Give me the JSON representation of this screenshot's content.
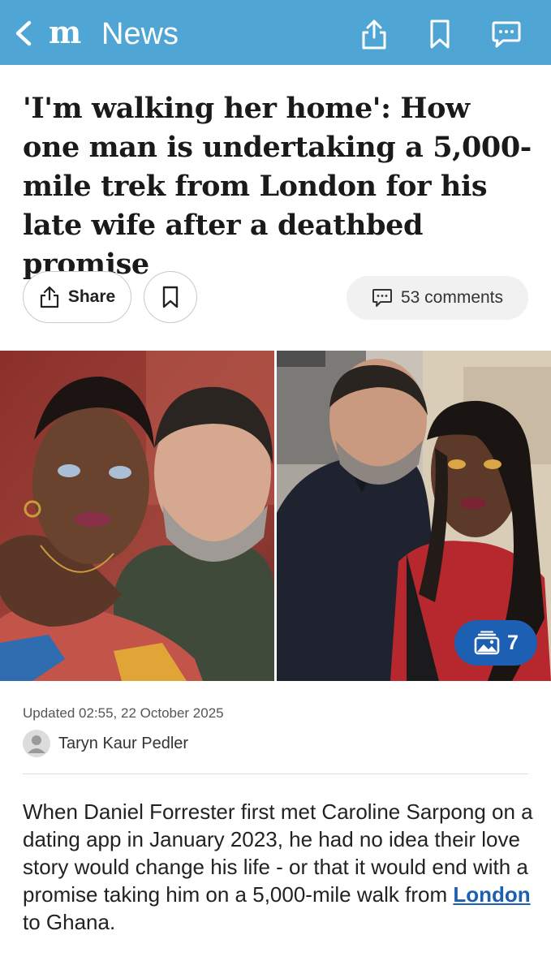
{
  "header": {
    "logo": "m",
    "section": "News",
    "icons": [
      "back-chevron-icon",
      "share-upload-icon",
      "bookmark-icon",
      "comment-icon"
    ]
  },
  "article": {
    "headline": "'I'm walking her home': How one man is undertaking a 5,000-mile trek from London for his late wife after a deathbed promise",
    "share_label": "Share",
    "comments_label": "53 comments",
    "gallery_count": "7",
    "updated": "Updated 02:55, 22 October 2025",
    "author": "Taryn Kaur Pedler",
    "body_before_link": "When Daniel Forrester first met Caroline Sarpong on a dating app in January 2023, he had no idea their love story would change his life - or that it would end with a promise taking him on a 5,000-mile walk from ",
    "body_link": "London",
    "body_after_link": " to Ghana."
  },
  "colors": {
    "header_bg": "#4fa6d4",
    "link": "#1d5fb3",
    "gallery_badge": "#1d5fb3"
  }
}
